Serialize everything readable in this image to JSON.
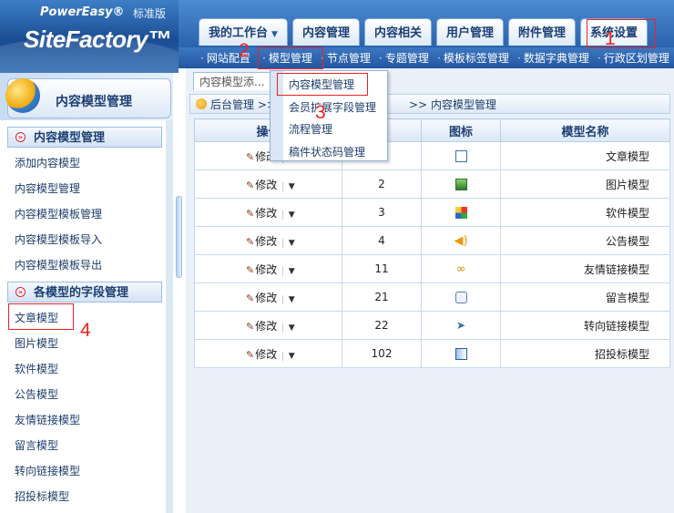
{
  "header": {
    "logo_top": "PowerEasy®",
    "logo_main": "SiteFactory™",
    "edition": "标准版",
    "tabs": [
      {
        "label": "我的工作台"
      },
      {
        "label": "内容管理"
      },
      {
        "label": "内容相关"
      },
      {
        "label": "用户管理"
      },
      {
        "label": "附件管理"
      },
      {
        "label": "系统设置"
      }
    ],
    "subnav": [
      "网站配置",
      "模型管理",
      "节点管理",
      "专题管理",
      "模板标签管理",
      "数据字典管理",
      "行政区划管理"
    ]
  },
  "dropdown": {
    "items": [
      "内容模型管理",
      "会员扩展字段管理",
      "流程管理",
      "稿件状态码管理"
    ]
  },
  "left_panel": {
    "title": "内容模型管理",
    "section1": {
      "title": "内容模型管理",
      "links": [
        "添加内容模型",
        "内容模型管理",
        "内容模型模板管理",
        "内容模型模板导入",
        "内容模型模板导出"
      ]
    },
    "section2": {
      "title": "各模型的字段管理",
      "links": [
        "文章模型",
        "图片模型",
        "软件模型",
        "公告模型",
        "友情链接模型",
        "留言模型",
        "转向链接模型",
        "招投标模型"
      ]
    }
  },
  "main": {
    "tab_label": "内容模型添...",
    "breadcrumb": {
      "home": "后台管理",
      "sep": ">>",
      "mid": ">>",
      "current": "内容模型管理"
    },
    "table": {
      "headers": [
        "操作",
        "ID",
        "图标",
        "模型名称"
      ],
      "edit_label": "修改",
      "rows": [
        {
          "id": "",
          "icon": "doc-icon",
          "name": "文章模型"
        },
        {
          "id": "2",
          "icon": "image-icon",
          "name": "图片模型"
        },
        {
          "id": "3",
          "icon": "software-icon",
          "name": "软件模型"
        },
        {
          "id": "4",
          "icon": "speaker-icon",
          "name": "公告模型"
        },
        {
          "id": "11",
          "icon": "link-icon",
          "name": "友情链接模型"
        },
        {
          "id": "21",
          "icon": "message-icon",
          "name": "留言模型"
        },
        {
          "id": "22",
          "icon": "redirect-icon",
          "name": "转向链接模型"
        },
        {
          "id": "102",
          "icon": "bid-icon",
          "name": "招投标模型"
        }
      ]
    }
  },
  "annotations": {
    "n1": "1",
    "n2": "2",
    "n3": "3",
    "n4": "4"
  },
  "colors": {
    "annotation": "#ee2222",
    "header_blue": "#2a63ad",
    "link": "#1d3d6b"
  }
}
